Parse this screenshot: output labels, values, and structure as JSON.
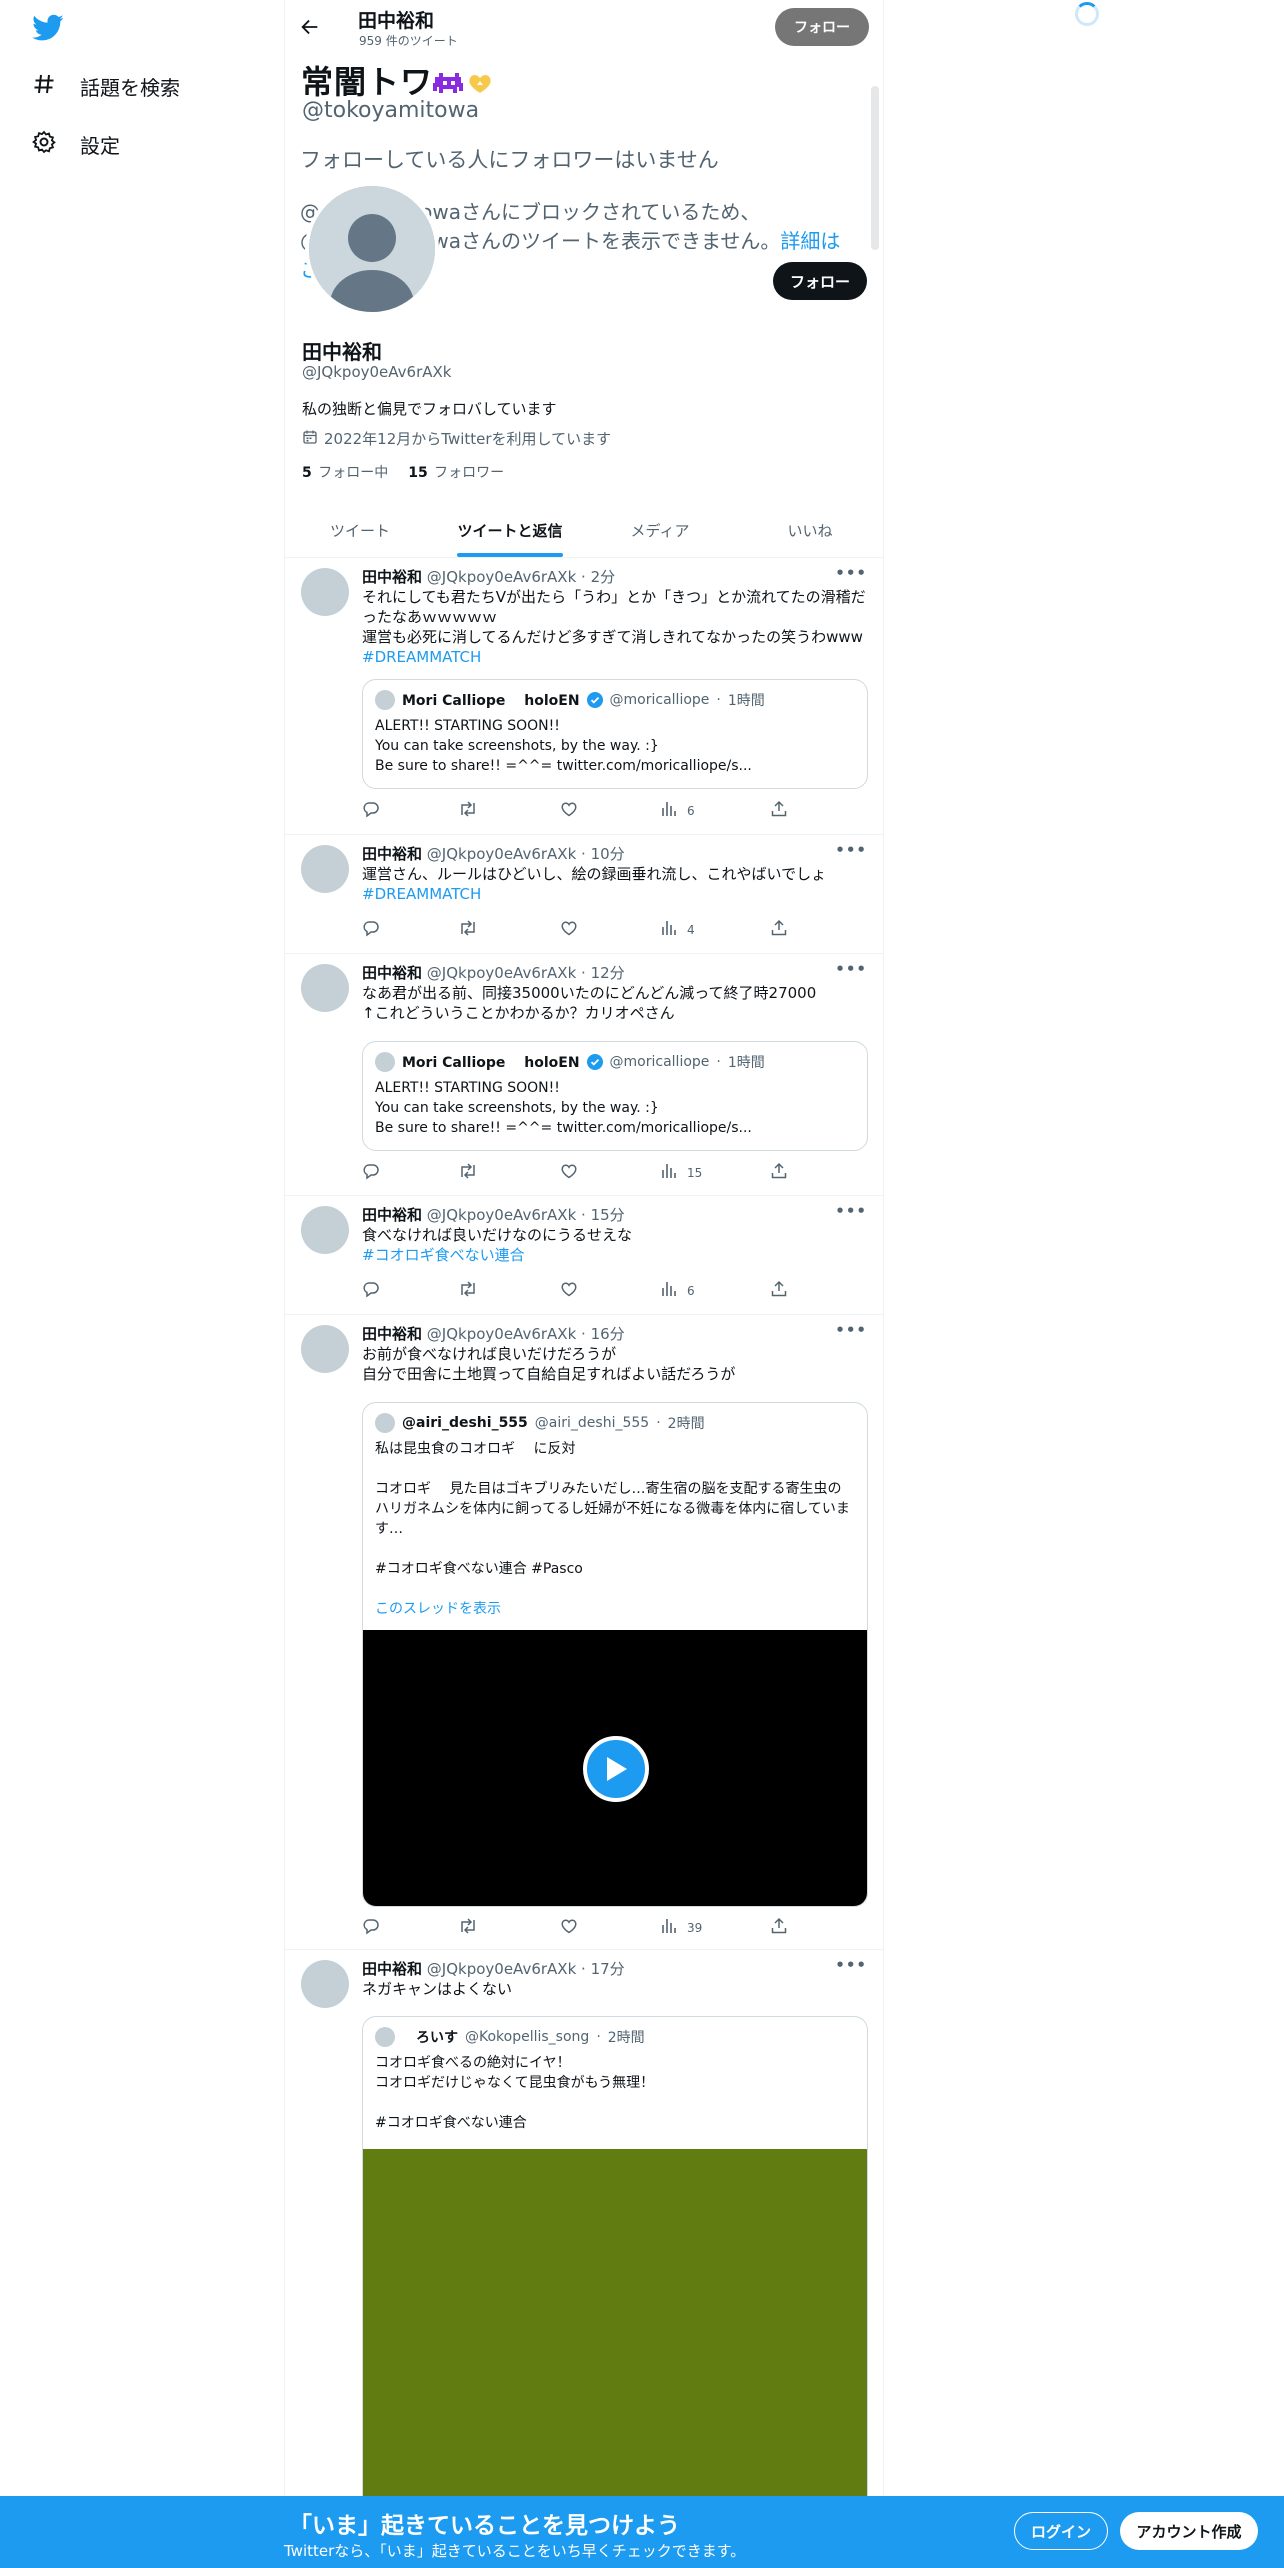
{
  "nav": {
    "logo": "twitter-bird-icon",
    "explore_label": "話題を検索",
    "settings_label": "設定"
  },
  "header": {
    "name": "田中裕和",
    "tweet_count": "959 件のツイート",
    "follow_label": "フォロー"
  },
  "overlay": {
    "display_name": "常闇トワ",
    "handle": "@tokoyamitowa",
    "no_followers": "フォローしている人にフォロワーはいません",
    "blocked_line1": "@tokoyamitowaさんにブロックされているため、",
    "blocked_line2": "@tokoyamitowaさんのツイートを表示できません。",
    "details_link": "詳細はこ"
  },
  "profile": {
    "name": "田中裕和",
    "handle": "@JQkpoy0eAv6rAXk",
    "bio": "私の独断と偏見でフォロバしています",
    "joined": "2022年12月からTwitterを利用しています",
    "following_count": "5",
    "following_label": "フォロー中",
    "followers_count": "15",
    "followers_label": "フォロワー",
    "follow_label": "フォロー"
  },
  "tabs": [
    "ツイート",
    "ツイートと返信",
    "メディア",
    "いいね"
  ],
  "tweets": [
    {
      "name": "田中裕和",
      "handle": "@JQkpoy0eAv6rAXk",
      "time": "2分",
      "text": "それにしても君たちVが出たら「うわ」とか「きつ」とか流れてたの滑稽だったなあｗｗｗｗｗ\n運営も必死に消してるんだけど多すぎて消しきれてなかったの笑うわwww",
      "hashtag": "#DREAMMATCH",
      "views": "6",
      "quote": {
        "name": "Mori Calliope　 holoEN",
        "handle": "@moricalliope",
        "time": "1時間",
        "text": "ALERT!! STARTING SOON!!\nYou can take screenshots, by the way. :}\nBe sure to share!! =^^= twitter.com/moricalliope/s..."
      }
    },
    {
      "name": "田中裕和",
      "handle": "@JQkpoy0eAv6rAXk",
      "time": "10分",
      "text": "運営さん、ルールはひどいし、絵の録画垂れ流し、これやばいでしょ",
      "hashtag": "#DREAMMATCH",
      "views": "4"
    },
    {
      "name": "田中裕和",
      "handle": "@JQkpoy0eAv6rAXk",
      "time": "12分",
      "text": "なあ君が出る前、同接35000いたのにどんどん減って終了時27000\n↑これどういうことかわかるか？カリオペさん",
      "views": "15",
      "quote": {
        "name": "Mori Calliope　 holoEN",
        "handle": "@moricalliope",
        "time": "1時間",
        "text": "ALERT!! STARTING SOON!!\nYou can take screenshots, by the way. :}\nBe sure to share!! =^^= twitter.com/moricalliope/s..."
      }
    },
    {
      "name": "田中裕和",
      "handle": "@JQkpoy0eAv6rAXk",
      "time": "15分",
      "text": "食べなければ良いだけなのにうるせえな",
      "hashtag": "#コオロギ食べない連合",
      "views": "6"
    },
    {
      "name": "田中裕和",
      "handle": "@JQkpoy0eAv6rAXk",
      "time": "16分",
      "text": "お前が食べなければ良いだけだろうが\n自分で田舎に土地買って自給自足すればよい話だろうが",
      "views": "39",
      "quote": {
        "name": "@airi_deshi_555",
        "handle": "@airi_deshi_555",
        "time": "2時間",
        "text": "私は昆虫食のコオロギ　 に反対\n\nコオロギ　 見た目はゴキブリみたいだし…寄生宿の脳を支配する寄生虫のハリガネムシを体内に飼ってるし妊婦が不妊になる微毒を体内に宿しています…\n\n#コオロギ食べない連合 #Pasco",
        "thread_link": "このスレッドを表示"
      }
    },
    {
      "name": "田中裕和",
      "handle": "@JQkpoy0eAv6rAXk",
      "time": "17分",
      "text": "ネガキャンはよくない",
      "quote": {
        "name": "　ろいす",
        "handle": "@Kokopellis_song",
        "time": "2時間",
        "text": "コオロギ食べるの絶対にイヤ！\nコオロギだけじゃなくて昆虫食がもう無理！\n\n#コオロギ食べない連合"
      }
    }
  ],
  "banner": {
    "title": "「いま」起きていることを見つけよう",
    "subtitle": "Twitterなら、「いま」起きていることをいち早くチェックできます。",
    "login_label": "ログイン",
    "signup_label": "アカウント作成"
  },
  "colors": {
    "brand": "#1d9bf0",
    "text": "#0f1419",
    "muted": "#536471",
    "video_bg": "#000000",
    "image_bg": "#617d12"
  }
}
